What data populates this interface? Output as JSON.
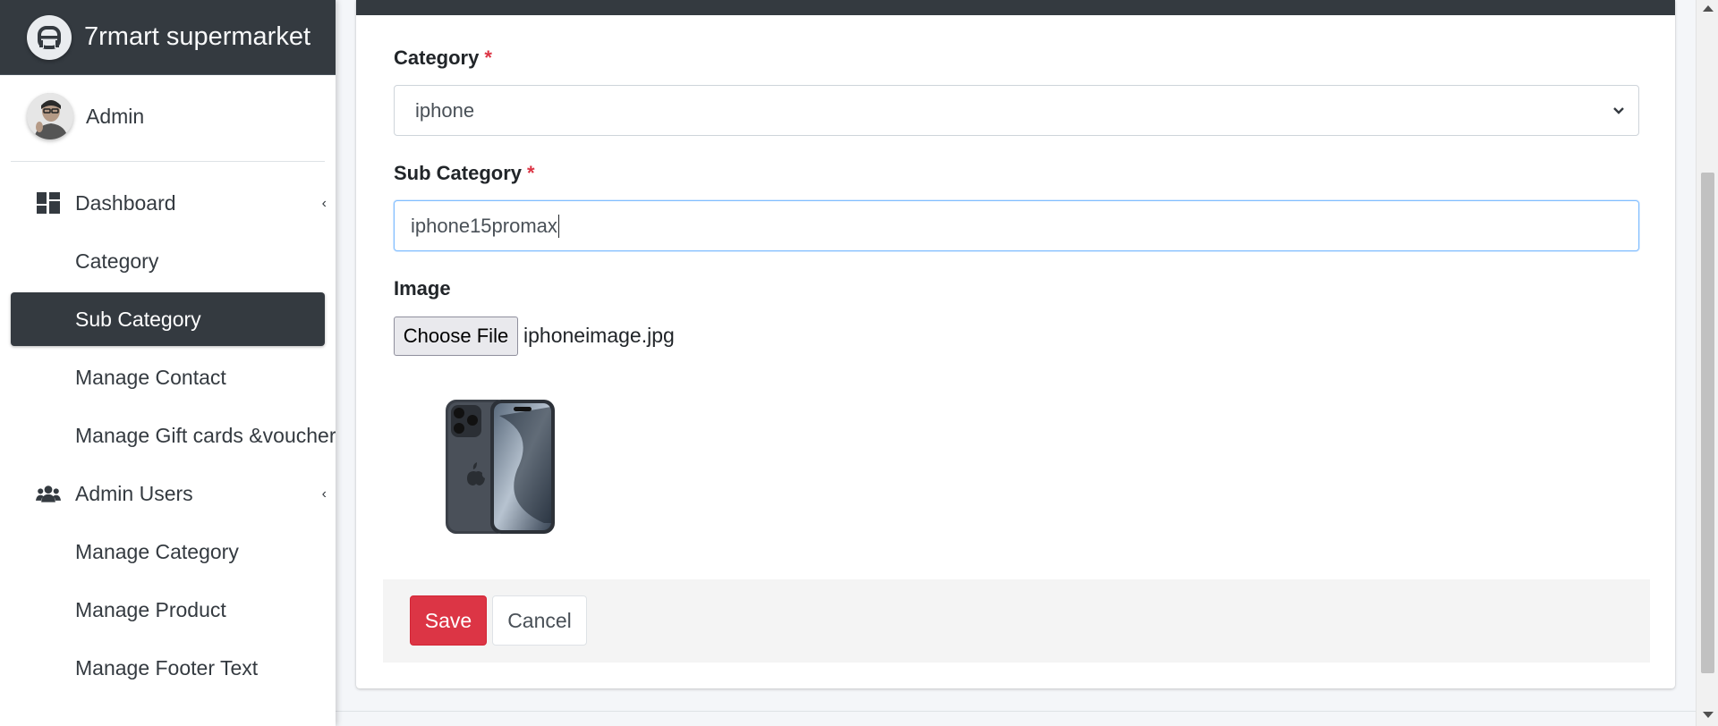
{
  "brand": {
    "title": "7rmart supermarket"
  },
  "user": {
    "name": "Admin"
  },
  "sidebar": {
    "items": [
      {
        "label": "Dashboard",
        "icon": "dashboard-icon",
        "has_caret": true
      },
      {
        "label": "Category"
      },
      {
        "label": "Sub Category",
        "active": true
      },
      {
        "label": "Manage Contact"
      },
      {
        "label": "Manage Gift cards &voucher"
      },
      {
        "label": "Admin Users",
        "icon": "users-icon",
        "has_caret": true
      },
      {
        "label": "Manage Category"
      },
      {
        "label": "Manage Product"
      },
      {
        "label": "Manage Footer Text"
      }
    ]
  },
  "form": {
    "category": {
      "label": "Category",
      "required_mark": "*",
      "value": "iphone"
    },
    "sub_category": {
      "label": "Sub Category",
      "required_mark": "*",
      "value": "iphone15promax"
    },
    "image": {
      "label": "Image",
      "button_label": "Choose File",
      "file_name": "iphoneimage.jpg"
    },
    "save_label": "Save",
    "cancel_label": "Cancel"
  },
  "colors": {
    "header": "#343a40",
    "danger": "#dc3545",
    "focus": "#80bdff"
  }
}
